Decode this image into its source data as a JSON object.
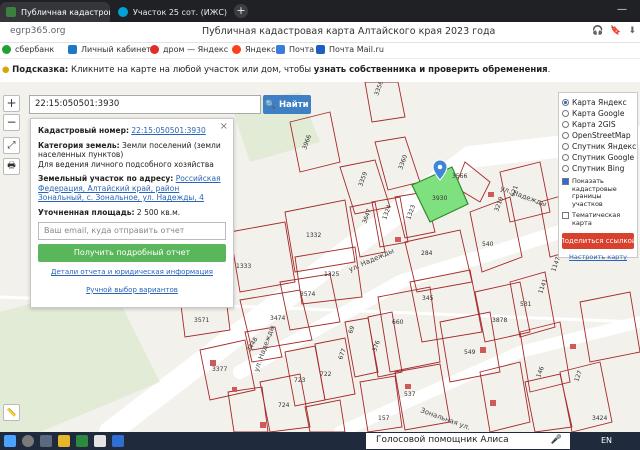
{
  "tabs": [
    {
      "title": "Публичная кадастрова",
      "close": "×",
      "active": true,
      "fav_color": "#3d7f3e"
    },
    {
      "title": "Участок 25 сот. (ИЖС) на",
      "close": "×",
      "active": false,
      "fav_color": "#00a3d9"
    }
  ],
  "newtab": "+",
  "window_min": "—",
  "address": {
    "url": "egrp365.org",
    "title": "Публичная кадастровая карта Алтайского края 2023 года",
    "icons": [
      "🎧",
      "🔖",
      "⬇"
    ]
  },
  "bookmarks": [
    {
      "label": "сбербанк",
      "color": "#21a038"
    },
    {
      "label": "Личный кабинет",
      "color": "#1e78c8"
    },
    {
      "label": "дром — Яндекс",
      "color": "#e32b2b"
    },
    {
      "label": "Яндекс",
      "color": "#fc3f1d"
    },
    {
      "label": "Почта",
      "color": "#3b7ddd"
    },
    {
      "label": "Почта Mail.ru",
      "color": "#1c5fc2"
    }
  ],
  "hint": {
    "prefix": "Подсказка:",
    "text": "Кликните на карте на любой участок или дом, чтобы",
    "bold_tail": "узнать собственника и проверить обременения",
    "end": "."
  },
  "search": {
    "value": "22:15:050501:3930",
    "button": "Найти"
  },
  "controls": {
    "zoom_in": "+",
    "zoom_out": "−",
    "fullscreen": "⤢",
    "print": "🖶",
    "ruler": "📏"
  },
  "popup": {
    "close": "×",
    "cadnum_label": "Кадастровый номер:",
    "cadnum_value": "22:15:050501:3930",
    "category_label": "Категория земель:",
    "category_value": "Земли поселений (земли населенных пунктов)",
    "usage": "Для ведения личного подсобного хозяйства",
    "address_label": "Земельный участок по адресу:",
    "address_value": "Российская Федерация, Алтайский край, район Зональный, с. Зональное, ул. Надежды, 4",
    "area_label": "Уточненная площадь:",
    "area_value": "2 500 кв.м.",
    "email_placeholder": "Ваш email, куда отправить отчет",
    "report_button": "Получить подробный отчет",
    "details_link": "Детали отчета и юридическая информация",
    "manual_link": "Ручной выбор вариантов"
  },
  "layers": {
    "items": [
      {
        "label": "Карта Яндекс",
        "selected": true
      },
      {
        "label": "Карта Google",
        "selected": false
      },
      {
        "label": "Карта 2GIS",
        "selected": false
      },
      {
        "label": "OpenStreetMap",
        "selected": false
      },
      {
        "label": "Спутник Яндекс",
        "selected": false
      },
      {
        "label": "Спутник Google",
        "selected": false
      },
      {
        "label": "Спутник Bing",
        "selected": false
      }
    ],
    "opt_borders": "Показать кадастровые границы участков",
    "opt_theme": "Тематическая карта",
    "share_button": "Поделиться ссылкой",
    "setup_link": "Настроить карту"
  },
  "map": {
    "street_1": "ул. Надежды",
    "street_2": "ул. Надежды",
    "street_3": "ул. Надежды",
    "street_4": "Зональная ул.",
    "parcels": [
      "3966",
      "3356",
      "3360",
      "3359",
      "3566",
      "3930",
      "1323",
      "1332",
      "1333",
      "1325",
      "3574",
      "3474",
      "3571",
      "3377",
      "3448",
      "723",
      "722",
      "724",
      "284",
      "540",
      "345",
      "660",
      "549",
      "3878",
      "531",
      "1141",
      "1147",
      "3219",
      "621",
      "146",
      "157",
      "127",
      "3424",
      "3647",
      "1324",
      "677",
      "69",
      "376",
      "537"
    ]
  },
  "taskbar": {
    "voice": "Голосовой помощник Алиса",
    "mic": "🎤",
    "lang": "EN"
  }
}
